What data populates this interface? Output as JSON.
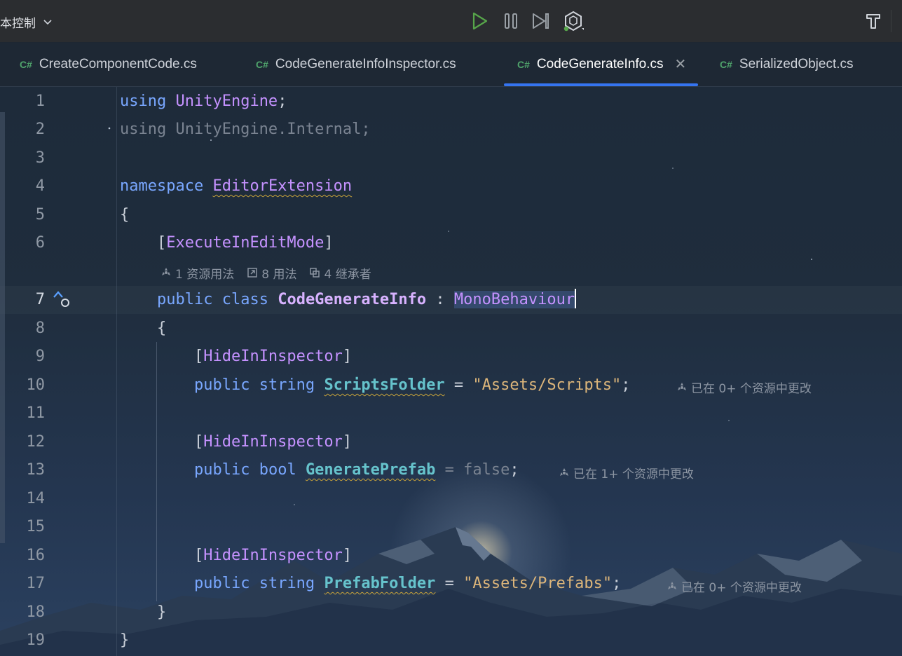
{
  "toolbar": {
    "run_config_label": "本控制",
    "buttons": [
      "play-icon",
      "pause-icon",
      "step-icon",
      "unity-attach-icon",
      "build-hammer-icon"
    ]
  },
  "tabs": [
    {
      "label": "CreateComponentCode.cs",
      "lang": "C#",
      "active": false
    },
    {
      "label": "CodeGenerateInfoInspector.cs",
      "lang": "C#",
      "active": false
    },
    {
      "label": "CodeGenerateInfo.cs",
      "lang": "C#",
      "active": true
    },
    {
      "label": "SerializedObject.cs",
      "lang": "C#",
      "active": false
    }
  ],
  "editor": {
    "line_numbers": [
      "1",
      "2",
      "3",
      "4",
      "5",
      "6",
      "7",
      "8",
      "9",
      "10",
      "11",
      "12",
      "13",
      "14",
      "15",
      "16",
      "17",
      "18",
      "19"
    ],
    "current_line": "7",
    "tokens": {
      "l1_using": "using",
      "l1_ns": "UnityEngine",
      "l1_semi": ";",
      "l2_text": "using UnityEngine.Internal;",
      "l4_namespace": "namespace",
      "l4_name": "EditorExtension",
      "l5_brace": "{",
      "l6_open": "[",
      "l6_attr": "ExecuteInEditMode",
      "l6_close": "]",
      "l7_public": "public",
      "l7_class": "class",
      "l7_name": "CodeGenerateInfo",
      "l7_colon": ":",
      "l7_base": "MonoBehaviour",
      "l8_brace": "{",
      "l9_open": "[",
      "l9_attr": "HideInInspector",
      "l9_close": "]",
      "l10_public": "public",
      "l10_type": "string",
      "l10_field": "ScriptsFolder",
      "l10_eq": "=",
      "l10_value": "\"Assets/Scripts\"",
      "l10_semi": ";",
      "l12_open": "[",
      "l12_attr": "HideInInspector",
      "l12_close": "]",
      "l13_public": "public",
      "l13_type": "bool",
      "l13_field": "GeneratePrefab",
      "l13_eq": "=",
      "l13_value": "false",
      "l13_semi": ";",
      "l16_open": "[",
      "l16_attr": "HideInInspector",
      "l16_close": "]",
      "l17_public": "public",
      "l17_type": "string",
      "l17_field": "PrefabFolder",
      "l17_eq": "=",
      "l17_value": "\"Assets/Prefabs\"",
      "l17_semi": ";",
      "l18_brace": "}",
      "l19_brace": "}"
    },
    "code_lens": {
      "asset_usages": "1 资源用法",
      "usages": "8 用法",
      "inheritors": "4 继承者"
    },
    "inlay_hints": {
      "l10": "已在 0+ 个资源中更改",
      "l13": "已在 1+ 个资源中更改",
      "l17": "已在 0+ 个资源中更改"
    }
  },
  "colors": {
    "keyword": "#79a7ff",
    "type": "#c592ff",
    "field": "#66c3cc",
    "string": "#dcb57a",
    "tab_active_underline": "#3574f0",
    "run_green": "#4fa36b"
  }
}
